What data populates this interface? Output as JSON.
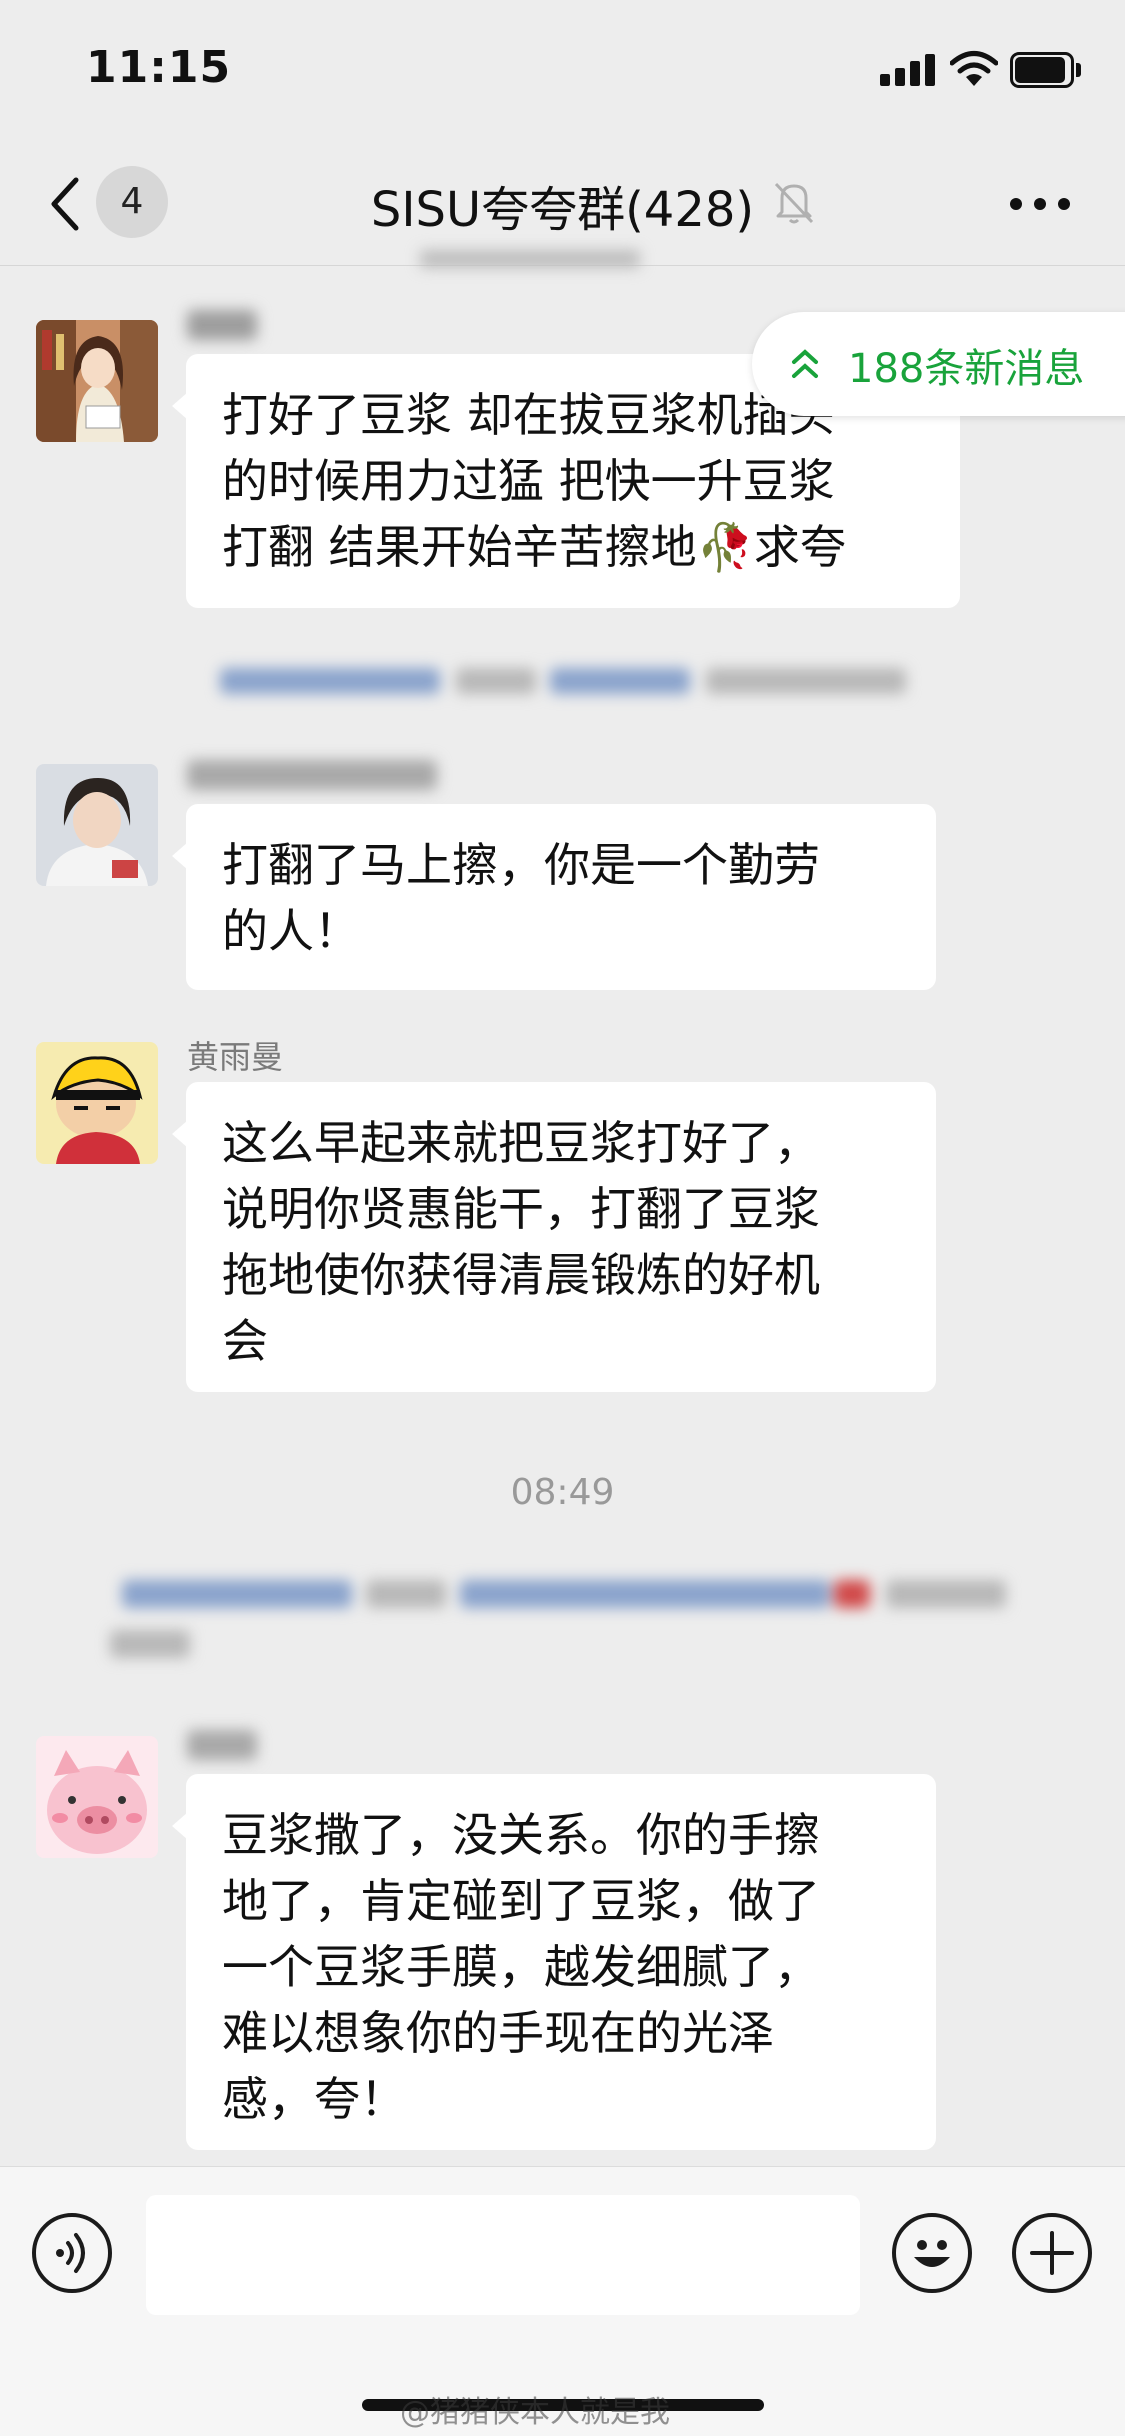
{
  "status": {
    "time": "11:15"
  },
  "nav": {
    "back_count": "4",
    "title": "SISU夸夸群(428)"
  },
  "new_messages": {
    "label": "188条新消息"
  },
  "messages": [
    {
      "sender": "",
      "text": "打好了豆浆 却在拔豆浆机插头\n的时候用力过猛 把快一升豆浆\n打翻 结果开始辛苦擦地🥀求夸"
    },
    {
      "sender": "",
      "text": "打翻了马上擦，你是一个勤劳\n的人！"
    },
    {
      "sender": "黄雨曼",
      "text": "这么早起来就把豆浆打好了，\n说明你贤惠能干，打翻了豆浆\n拖地使你获得清晨锻炼的好机\n会"
    },
    {
      "sender": "",
      "text": "豆浆撒了，没关系。你的手擦\n地了，肯定碰到了豆浆，做了\n一个豆浆手膜，越发细腻了，\n难以想象你的手现在的光泽\n感，夸！"
    }
  ],
  "timestamp": "08:49",
  "watermark": "@猪猪侠本人就是我",
  "colors": {
    "background": "#ededed",
    "bubble": "#ffffff",
    "accent_green": "#19a33b",
    "link_blue": "#5d7fb0"
  },
  "icons": {
    "back": "chevron-left-icon",
    "mute": "bell-slash-icon",
    "more": "ellipsis-icon",
    "voice": "voice-icon",
    "emoji": "emoji-icon",
    "add": "plus-icon"
  }
}
